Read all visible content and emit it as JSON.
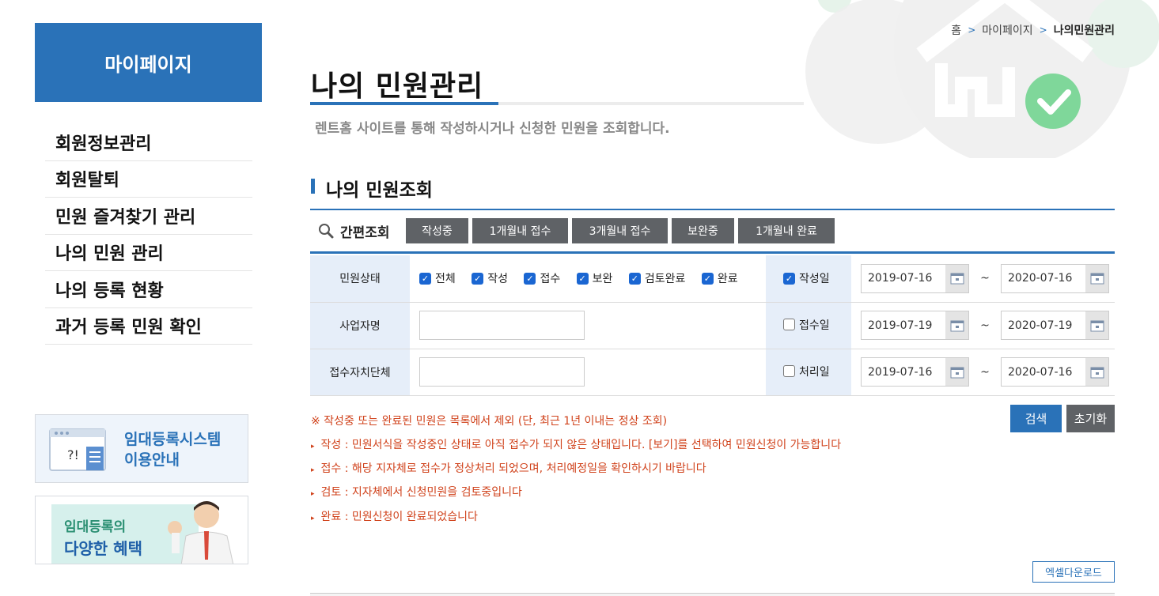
{
  "breadcrumb": {
    "home": "홈",
    "mypage": "마이페이지",
    "current": "나의민원관리"
  },
  "sidebar": {
    "title": "마이페이지",
    "items": [
      {
        "label": "회원정보관리"
      },
      {
        "label": "회원탈퇴"
      },
      {
        "label": "민원 즐겨찾기 관리"
      },
      {
        "label": "나의 민원 관리"
      },
      {
        "label": "나의 등록 현황"
      },
      {
        "label": "과거 등록 민원 확인"
      }
    ]
  },
  "banners": {
    "guide": {
      "line1": "임대등록시스템",
      "line2": "이용안내"
    },
    "benefit": {
      "line1": "임대등록의",
      "line2": "다양한 혜택"
    }
  },
  "page": {
    "title": "나의 민원관리",
    "description": "렌트홈 사이트를 통해 작성하시거나 신청한 민원을 조회합니다."
  },
  "section": {
    "title": "나의 민원조회"
  },
  "quick": {
    "label": "간편조회",
    "buttons": [
      "작성중",
      "1개월내 접수",
      "3개월내 접수",
      "보완중",
      "1개월내 완료"
    ]
  },
  "form": {
    "status_label": "민원상태",
    "status_options": [
      {
        "label": "전체",
        "checked": true
      },
      {
        "label": "작성",
        "checked": true
      },
      {
        "label": "접수",
        "checked": true
      },
      {
        "label": "보완",
        "checked": true
      },
      {
        "label": "검토완료",
        "checked": true
      },
      {
        "label": "완료",
        "checked": true
      }
    ],
    "business_label": "사업자명",
    "business_value": "",
    "agency_label": "접수자치단체",
    "agency_value": "",
    "date_rows": [
      {
        "label": "작성일",
        "checked": true,
        "from": "2019-07-16",
        "to": "2020-07-16"
      },
      {
        "label": "접수일",
        "checked": false,
        "from": "2019-07-19",
        "to": "2020-07-19"
      },
      {
        "label": "처리일",
        "checked": false,
        "from": "2019-07-16",
        "to": "2020-07-16"
      }
    ],
    "tilde": "~"
  },
  "notices": {
    "main": "※ 작성중 또는 완료된 민원은 목록에서 제외 (단, 최근 1년 이내는 정상 조회)",
    "items": [
      "작성 : 민원서식을 작성중인 상태로 아직 접수가 되지 않은 상태입니다. [보기]를 선택하여 민원신청이 가능합니다",
      "접수 : 해당 지자체로 접수가 정상처리 되었으며, 처리예정일을 확인하시기 바랍니다",
      "검토 : 지자체에서 신청민원을 검토중입니다",
      "완료 : 민원신청이 완료되었습니다"
    ]
  },
  "actions": {
    "search": "검색",
    "reset": "초기화",
    "excel": "엑셀다운로드"
  },
  "colors": {
    "primary": "#2a72b8",
    "notice": "#d0421b",
    "dark_button": "#5f6266"
  }
}
